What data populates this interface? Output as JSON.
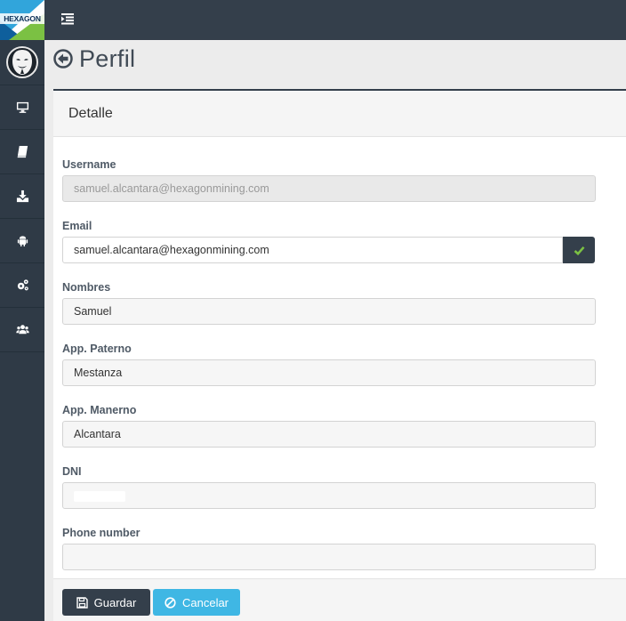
{
  "brand": {
    "logo_text": "HEXAGON"
  },
  "sidebar": {
    "items": [
      {
        "icon": "monitor-icon"
      },
      {
        "icon": "book-icon"
      },
      {
        "icon": "download-icon"
      },
      {
        "icon": "android-icon"
      },
      {
        "icon": "gears-icon"
      },
      {
        "icon": "users-icon"
      }
    ]
  },
  "header": {
    "title": "Perfil"
  },
  "panel": {
    "title": "Detalle"
  },
  "form": {
    "username": {
      "label": "Username",
      "value": "samuel.alcantara@hexagonmining.com"
    },
    "email": {
      "label": "Email",
      "value": "samuel.alcantara@hexagonmining.com"
    },
    "nombres": {
      "label": "Nombres",
      "value": "Samuel"
    },
    "app_paterno": {
      "label": "App. Paterno",
      "value": "Mestanza"
    },
    "app_manerno": {
      "label": "App. Manerno",
      "value": "Alcantara"
    },
    "dni": {
      "label": "DNI",
      "value": ""
    },
    "phone": {
      "label": "Phone number",
      "value": ""
    }
  },
  "actions": {
    "save_label": "Guardar",
    "cancel_label": "Cancelar"
  },
  "colors": {
    "dark": "#343f4b",
    "accent": "#3fb7e4",
    "success": "#7bc143"
  }
}
